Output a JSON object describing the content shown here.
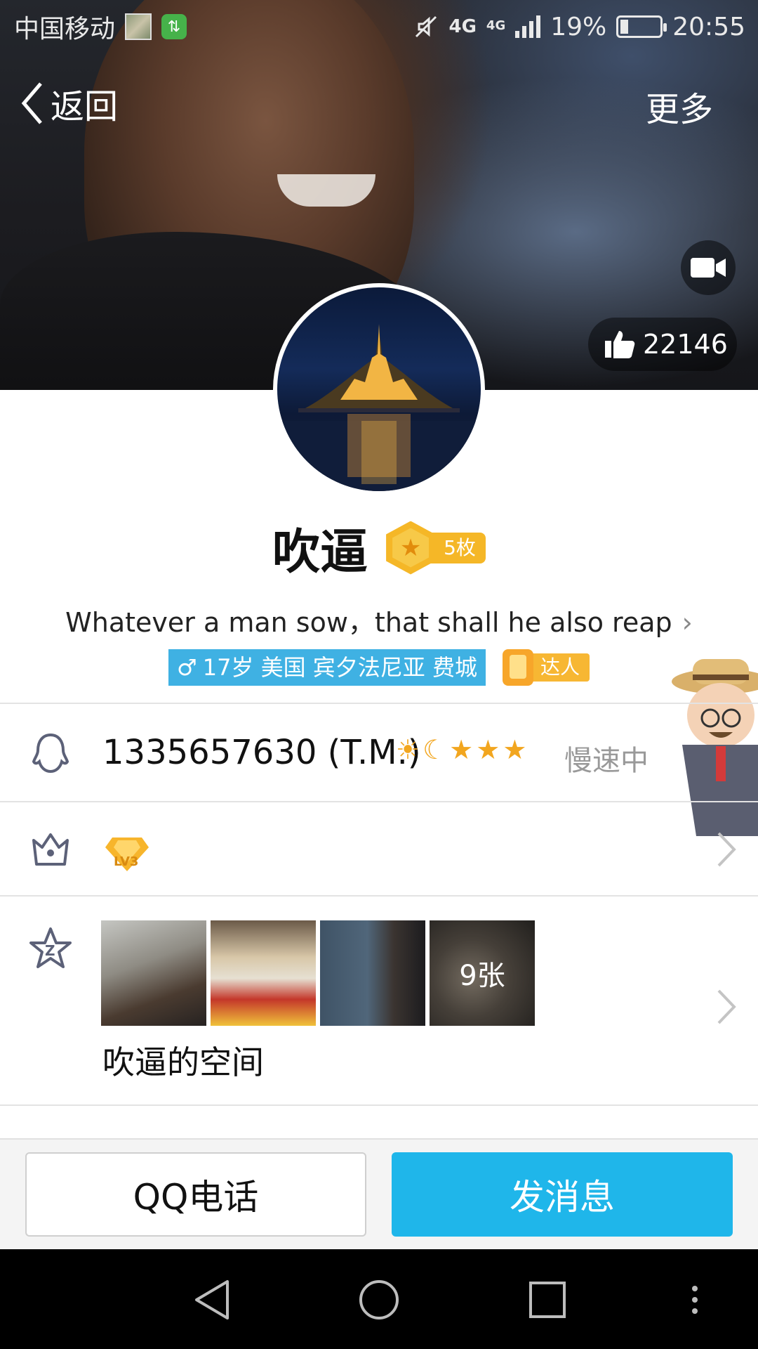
{
  "status_bar": {
    "carrier": "中国移动",
    "network_1": "4G",
    "network_2": "4G",
    "battery_percent": "19%",
    "battery_level": 0.19,
    "time": "20:55"
  },
  "nav": {
    "back_label": "返回",
    "more_label": "更多"
  },
  "likes": {
    "count": "22146"
  },
  "profile": {
    "name": "吹逼",
    "medal_count": "5枚",
    "motto": "Whatever a man sow，that shall he also reap",
    "info_tag": "17岁 美国 宾夕法尼亚 费城",
    "gender_symbol": "♂",
    "daren_label": "达人"
  },
  "qq_row": {
    "number": "1335657630 (T.M.)",
    "level_icons": [
      "☀",
      "☾",
      "★",
      "★",
      "★"
    ],
    "speed_status": "慢速中"
  },
  "vip_row": {
    "badge": "LV3"
  },
  "space_row": {
    "photo_count": "9张",
    "label": "吹逼的空间"
  },
  "actions": {
    "call_label": "QQ电话",
    "message_label": "发消息"
  },
  "colors": {
    "accent": "#1fb6ea",
    "info_tag": "#3fb1e3",
    "medal": "#f5b727"
  }
}
